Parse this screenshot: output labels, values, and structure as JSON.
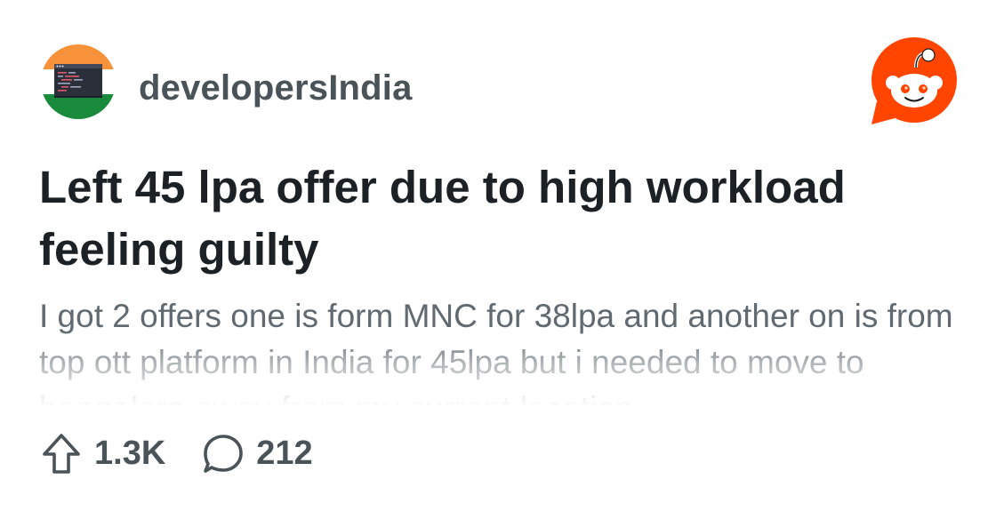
{
  "subreddit": {
    "name": "developersIndia",
    "avatar_icon": "india-flag-code-icon"
  },
  "brand": {
    "logo_icon": "reddit-snoo-icon",
    "color": "#ff4500"
  },
  "post": {
    "title": "Left 45 lpa offer due to high workload feeling guilty",
    "body_preview": "I got 2 offers one is form MNC for 38lpa and another on is from top ott platform in India for 45lpa but i needed to move to bangalore away from my current location"
  },
  "stats": {
    "upvotes": "1.3K",
    "comments": "212",
    "upvote_icon": "upvote-arrow-icon",
    "comment_icon": "comment-bubble-icon"
  },
  "colors": {
    "title": "#1b2125",
    "body": "#576268",
    "meta": "#4a5358",
    "flag_saffron": "#f7923a",
    "flag_green": "#1a8a3c"
  }
}
